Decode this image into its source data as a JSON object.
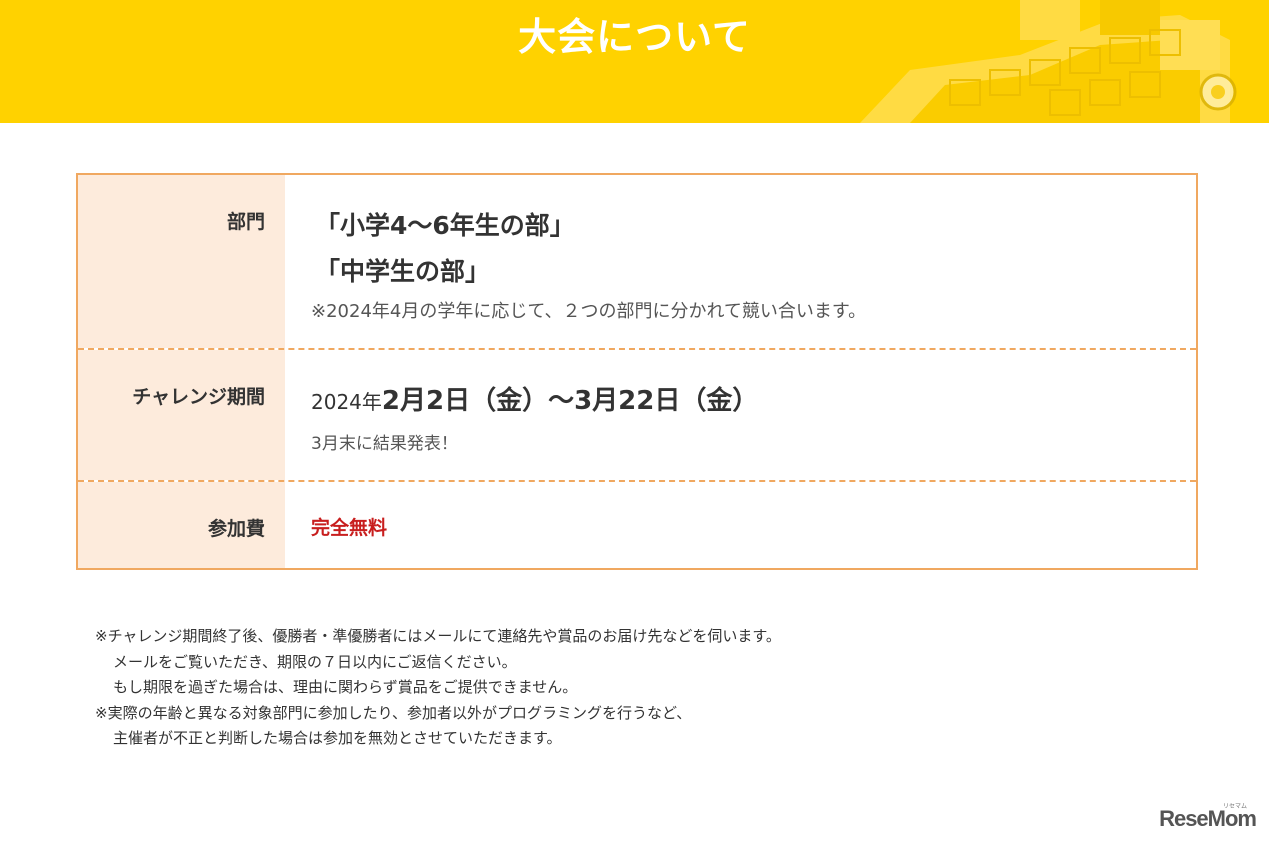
{
  "header": {
    "title": "大会について"
  },
  "table": {
    "division": {
      "label": "部門",
      "lines": [
        "「小学4〜6年生の部」",
        "「中学生の部」"
      ],
      "note": "※2024年4月の学年に応じて、２つの部門に分かれて競い合います。"
    },
    "period": {
      "label": "チャレンジ期間",
      "year": "2024年",
      "dates": "2月2日（金）〜3月22日（金）",
      "sub": "3月末に結果発表！"
    },
    "fee": {
      "label": "参加費",
      "value": "完全無料"
    }
  },
  "notes": [
    "※チャレンジ期間終了後、優勝者・準優勝者にはメールにて連絡先や賞品のお届け先などを伺います。",
    "メールをご覧いただき、期限の７日以内にご返信ください。",
    "もし期限を過ぎた場合は、理由に関わらず賞品をご提供できません。",
    "※実際の年齢と異なる対象部門に参加したり、参加者以外がプログラミングを行うなど、",
    "主催者が不正と判断した場合は参加を無効とさせていただきます。"
  ],
  "logo": {
    "text": "ReseMom",
    "small": "リセマム"
  },
  "colors": {
    "header_bg": "#ffd200",
    "border": "#f0a860",
    "label_bg": "#fdebdc",
    "free": "#c81e1e"
  }
}
